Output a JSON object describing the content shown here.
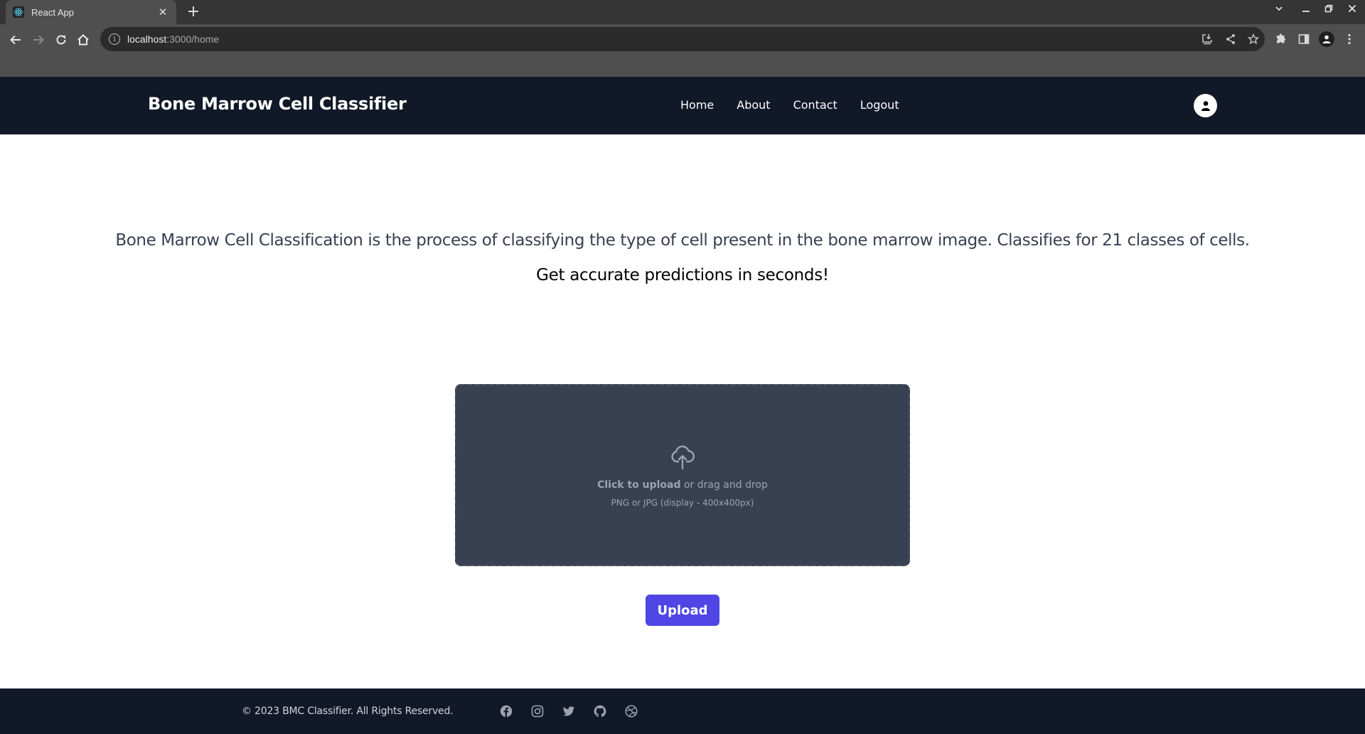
{
  "browser": {
    "tab_title": "React App",
    "url_host": "localhost",
    "url_path": ":3000/home"
  },
  "nav": {
    "brand": "Bone Marrow Cell Classifier",
    "links": [
      "Home",
      "About",
      "Contact",
      "Logout"
    ]
  },
  "main": {
    "description": "Bone Marrow Cell Classification is the process of classifying the type of cell present in the bone marrow image. Classifies for 21 classes of cells.",
    "tagline": "Get accurate predictions in seconds!",
    "dropzone": {
      "primary_bold": "Click to upload",
      "primary_rest": " or drag and drop",
      "hint": "PNG or JPG (display - 400x400px)"
    },
    "upload_label": "Upload"
  },
  "footer": {
    "copyright": "© 2023 BMC Classifier. All Rights Reserved.",
    "social_icons": [
      "facebook-icon",
      "instagram-icon",
      "twitter-icon",
      "github-icon",
      "dribbble-icon"
    ]
  },
  "colors": {
    "nav_bg": "#111827",
    "dropzone_bg": "#374151",
    "accent": "#4f46e5"
  }
}
